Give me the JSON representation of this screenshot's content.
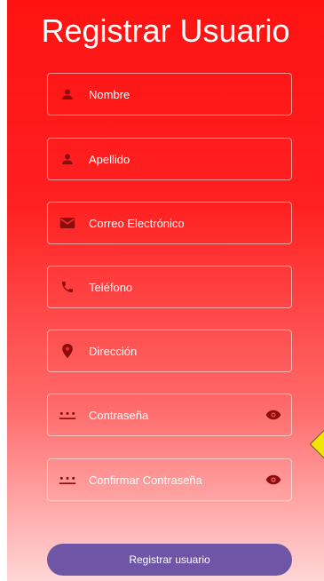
{
  "title": "Registrar Usuario",
  "fields": {
    "nombre": {
      "label": "Nombre",
      "icon": "person-icon"
    },
    "apellido": {
      "label": "Apellido",
      "icon": "person-icon"
    },
    "correo": {
      "label": "Correo Electrónico",
      "icon": "email-icon"
    },
    "telefono": {
      "label": "Teléfono",
      "icon": "phone-icon"
    },
    "direccion": {
      "label": "Dirección",
      "icon": "location-pin-icon"
    },
    "contrasena": {
      "label": "Contraseña",
      "icon": "password-icon",
      "toggle_icon": "eye-icon"
    },
    "confirmar": {
      "label": "Confirmar Contraseña",
      "icon": "password-icon",
      "toggle_icon": "eye-icon"
    }
  },
  "submit_label": "Registrar usuario",
  "colors": {
    "background_top": "#ff1212",
    "background_bottom": "#ffd6d6",
    "button": "#6e55a6",
    "icon": "#8a0c0c",
    "marker": "#f2e600"
  }
}
